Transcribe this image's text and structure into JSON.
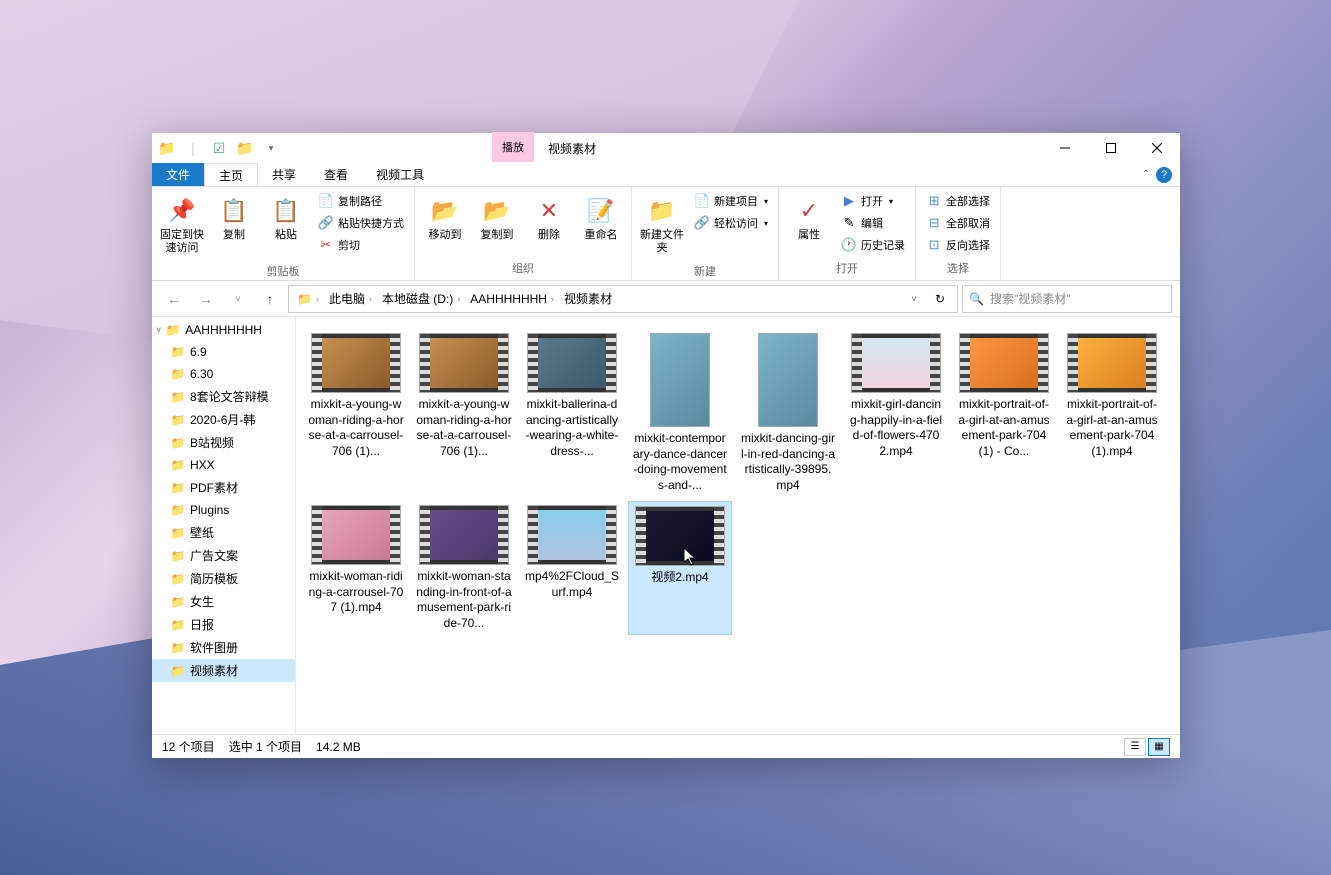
{
  "titlebar": {
    "context_tab": "播放",
    "window_title": "视频素材"
  },
  "tabs": {
    "file": "文件",
    "home": "主页",
    "share": "共享",
    "view": "查看",
    "video_tools": "视频工具"
  },
  "ribbon": {
    "clipboard": {
      "pin": "固定到快速访问",
      "copy": "复制",
      "paste": "粘贴",
      "copy_path": "复制路径",
      "paste_shortcut": "粘贴快捷方式",
      "cut": "剪切",
      "label": "剪贴板"
    },
    "organize": {
      "move_to": "移动到",
      "copy_to": "复制到",
      "delete": "删除",
      "rename": "重命名",
      "label": "组织"
    },
    "new": {
      "new_folder": "新建文件夹",
      "new_item": "新建项目",
      "easy_access": "轻松访问",
      "label": "新建"
    },
    "open": {
      "properties": "属性",
      "open": "打开",
      "edit": "编辑",
      "history": "历史记录",
      "label": "打开"
    },
    "select": {
      "select_all": "全部选择",
      "select_none": "全部取消",
      "invert": "反向选择",
      "label": "选择"
    }
  },
  "breadcrumb": {
    "segments": [
      "此电脑",
      "本地磁盘 (D:)",
      "AAHHHHHHH",
      "视频素材"
    ]
  },
  "search": {
    "placeholder": "搜索\"视频素材\""
  },
  "sidebar": {
    "root": "AAHHHHHHH",
    "items": [
      "6.9",
      "6.30",
      "8套论文答辩模",
      "2020-6月-韩",
      "B站视频",
      "HXX",
      "PDF素材",
      "Plugins",
      "壁纸",
      "广告文案",
      "简历模板",
      "女生",
      "日报",
      "软件图册",
      "视频素材"
    ]
  },
  "files": [
    {
      "name": "mixkit-a-young-woman-riding-a-horse-at-a-carrousel-706 (1)...",
      "thumb": "t1"
    },
    {
      "name": "mixkit-a-young-woman-riding-a-horse-at-a-carrousel-706 (1)...",
      "thumb": "t1"
    },
    {
      "name": "mixkit-ballerina-dancing-artistically-wearing-a-white-dress-...",
      "thumb": "t2"
    },
    {
      "name": "mixkit-contemporary-dance-dancer-doing-movements-and-...",
      "thumb": "tall1",
      "tall": true
    },
    {
      "name": "mixkit-dancing-girl-in-red-dancing-artistically-39895.mp4",
      "thumb": "tall2",
      "tall": true
    },
    {
      "name": "mixkit-girl-dancing-happily-in-a-field-of-flowers-4702.mp4",
      "thumb": "t9"
    },
    {
      "name": "mixkit-portrait-of-a-girl-at-an-amusement-park-704 (1) - Co...",
      "thumb": "t5"
    },
    {
      "name": "mixkit-portrait-of-a-girl-at-an-amusement-park-704 (1).mp4",
      "thumb": "t6"
    },
    {
      "name": "mixkit-woman-riding-a-carrousel-707 (1).mp4",
      "thumb": "t3"
    },
    {
      "name": "mixkit-woman-standing-in-front-of-amusement-park-ride-70...",
      "thumb": "t8"
    },
    {
      "name": "mp4%2FCloud_Surf.mp4",
      "thumb": "t4"
    },
    {
      "name": "视频2.mp4",
      "thumb": "t7",
      "selected": true
    }
  ],
  "statusbar": {
    "item_count": "12 个项目",
    "selection": "选中 1 个项目",
    "size": "14.2 MB"
  }
}
